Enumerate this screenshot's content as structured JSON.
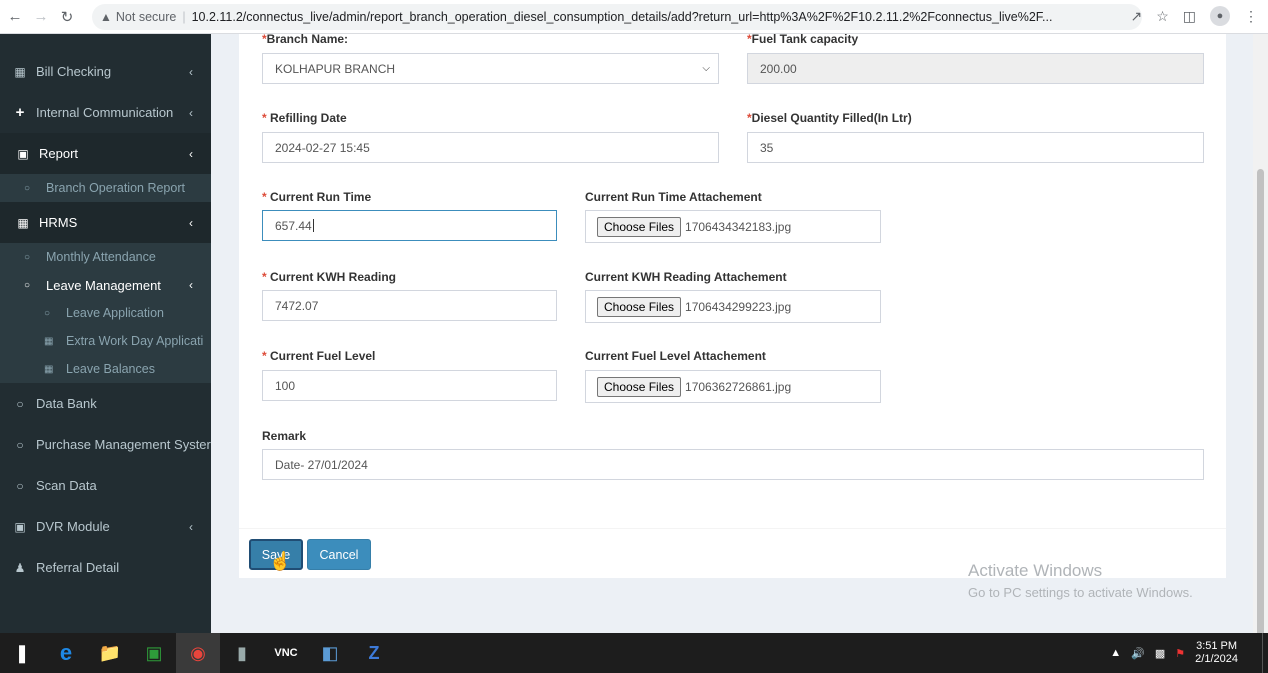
{
  "browser": {
    "url_warning": "Not secure",
    "url": "10.2.11.2/connectus_live/admin/report_branch_operation_diesel_consumption_details/add?return_url=http%3A%2F%2F10.2.11.2%2Fconnectus_live%2F..."
  },
  "sidebar": {
    "items": [
      {
        "label": "Bill Checking"
      },
      {
        "label": "Internal Communication"
      },
      {
        "label": "Report"
      },
      {
        "label": "Branch Operation Report"
      },
      {
        "label": "HRMS"
      },
      {
        "label": "Monthly Attendance"
      },
      {
        "label": "Leave Management"
      },
      {
        "label": "Leave Application"
      },
      {
        "label": "Extra Work Day Applicati"
      },
      {
        "label": "Leave Balances"
      },
      {
        "label": "Data Bank"
      },
      {
        "label": "Purchase Management Syster"
      },
      {
        "label": "Scan Data"
      },
      {
        "label": "DVR Module"
      },
      {
        "label": "Referral Detail"
      }
    ]
  },
  "form": {
    "branch_name": {
      "label": "Branch Name:",
      "value": "KOLHAPUR BRANCH"
    },
    "fuel_tank": {
      "label": "Fuel Tank capacity",
      "value": "200.00"
    },
    "refilling_date": {
      "label": "Refilling Date",
      "value": "2024-02-27 15:45"
    },
    "diesel_qty": {
      "label": "Diesel Quantity Filled(In Ltr)",
      "value": "35"
    },
    "run_time": {
      "label": "Current Run Time",
      "value": "657.44"
    },
    "run_time_attach": {
      "label": "Current Run Time Attachement",
      "button": "Choose Files",
      "file": "1706434342183.jpg"
    },
    "kwh": {
      "label": "Current KWH Reading",
      "value": "7472.07"
    },
    "kwh_attach": {
      "label": "Current KWH Reading Attachement",
      "button": "Choose Files",
      "file": "1706434299223.jpg"
    },
    "fuel_level": {
      "label": "Current Fuel Level",
      "value": "100"
    },
    "fuel_level_attach": {
      "label": "Current Fuel Level Attachement",
      "button": "Choose Files",
      "file": "1706362726861.jpg"
    },
    "remark": {
      "label": "Remark",
      "value": "Date- 27/01/2024"
    },
    "save_label": "Save",
    "cancel_label": "Cancel",
    "required_mark": "*"
  },
  "watermark": {
    "line1": "Activate Windows",
    "line2": "Go to PC settings to activate Windows."
  },
  "taskbar": {
    "time": "3:51 PM",
    "date": "2/1/2024"
  }
}
